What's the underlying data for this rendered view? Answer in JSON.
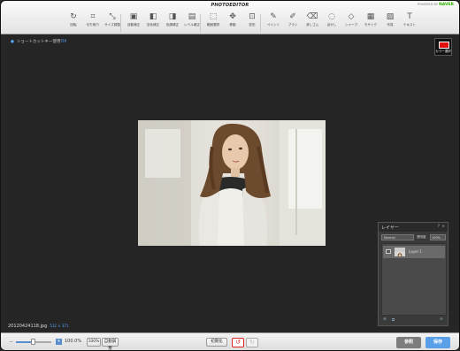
{
  "app": {
    "brand": "PHOTOEDITOR",
    "powered_by": "POWERED BY",
    "naver": "NAVER"
  },
  "tools": [
    {
      "label": "回転",
      "icon": "rotate-icon",
      "glyph": "↻"
    },
    {
      "label": "切り取り",
      "icon": "crop-icon",
      "glyph": "⌗"
    },
    {
      "label": "サイズ調整",
      "icon": "resize-icon",
      "glyph": "⤡"
    },
    {
      "label": "自動補正",
      "icon": "auto-correct-icon",
      "glyph": "▣"
    },
    {
      "label": "自色補正",
      "icon": "color-correct-icon",
      "glyph": "◧"
    },
    {
      "label": "色調補正",
      "icon": "tone-correct-icon",
      "glyph": "◨"
    },
    {
      "label": "レベル補正",
      "icon": "level-correct-icon",
      "glyph": "▤"
    },
    {
      "label": "範囲選択",
      "icon": "selection-icon",
      "glyph": "⬚"
    },
    {
      "label": "移動",
      "icon": "move-icon",
      "glyph": "✥"
    },
    {
      "label": "変形",
      "icon": "transform-icon",
      "glyph": "⊡"
    },
    {
      "label": "ペイント",
      "icon": "paint-icon",
      "glyph": "✎"
    },
    {
      "label": "ブラシ",
      "icon": "brush-icon",
      "glyph": "✐"
    },
    {
      "label": "消しゴム",
      "icon": "eraser-icon",
      "glyph": "⌫"
    },
    {
      "label": "ぼかし",
      "icon": "blur-icon",
      "glyph": "◌"
    },
    {
      "label": "シャープ",
      "icon": "sharpen-icon",
      "glyph": "◇"
    },
    {
      "label": "モザイク",
      "icon": "mosaic-icon",
      "glyph": "▦"
    },
    {
      "label": "写真",
      "icon": "photo-icon",
      "glyph": "▨"
    },
    {
      "label": "テキスト",
      "icon": "text-icon",
      "glyph": "T"
    }
  ],
  "canvas": {
    "tip_text": "ショートカットキー使用",
    "tip_key": "TIP",
    "color_label": "カラー選択",
    "color_value": "#e01010",
    "filename": "20120424118.jpg",
    "dimensions": "512 × 371"
  },
  "layer_panel": {
    "title": "レイヤー",
    "help": "?",
    "close": "×",
    "blend_mode": "Normal",
    "opacity_label": "透明度",
    "opacity_value": "100%",
    "layer_name": "Layer 1"
  },
  "bottom": {
    "zoom_minus": "−",
    "zoom_plus": "+",
    "zoom_level": 0.5,
    "zoom_value": "100.0%",
    "btn_100": "100%",
    "btn_fit": "自動調整",
    "btn_reset": "初期化",
    "btn_undo": "↺",
    "btn_redo": "↻",
    "btn_open": "参照",
    "btn_save": "保存",
    "open_color": "#7d7d7d",
    "save_color": "#5aa0e8"
  }
}
